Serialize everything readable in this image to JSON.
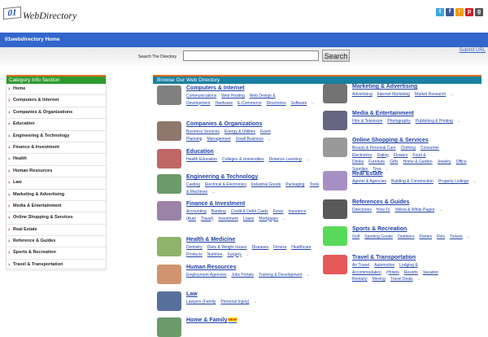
{
  "logo": {
    "num": "01",
    "name": "WebDirectory"
  },
  "social": [
    {
      "name": "twitter",
      "g": "t",
      "c": "#3aa7e0"
    },
    {
      "name": "facebook",
      "g": "f",
      "c": "#3b5998"
    },
    {
      "name": "rss",
      "g": "r",
      "c": "#f39c12"
    },
    {
      "name": "pinterest",
      "g": "p",
      "c": "#cb2027"
    },
    {
      "name": "google",
      "g": "g",
      "c": "#555555"
    }
  ],
  "nav": {
    "home": "01webdirectory Home"
  },
  "search": {
    "label": "Search The Directory",
    "value": "",
    "button": "Search",
    "submit_url": "Submit URL"
  },
  "sidebar": {
    "title": "Category Info Section",
    "items": [
      "Home",
      "Computers & Internet",
      "Companies & Organizations",
      "Education",
      "Engineering & Technology",
      "Finance & Investment",
      "Health",
      "Human Resources",
      "Law",
      "Marketing & Advertising",
      "Media & Entertainment",
      "Online Shopping & Services",
      "Real Estate",
      "Reference & Guides",
      "Sports & Recreation",
      "Travel & Transportation"
    ]
  },
  "directory": {
    "title": "Browse Our Web Directory",
    "left": [
      {
        "title": "Computers & Internet",
        "icon": "computer-icon",
        "subs": [
          "Communications",
          "Web Hosting",
          "Web Design & Development",
          "Hardware",
          "E-Commerce",
          "Directories",
          "Software"
        ]
      },
      {
        "title": "Companies & Organizations",
        "icon": "business-people-icon",
        "subs": [
          "Business Services",
          "Energy & Utilities",
          "Event Planning",
          "Management",
          "Small Business"
        ]
      },
      {
        "title": "Education",
        "icon": "book-icon",
        "subs": [
          "Health Education",
          "Colleges & Universities",
          "Distance Learning"
        ]
      },
      {
        "title": "Engineering & Technology",
        "icon": "engineer-icon",
        "subs": [
          "Casting",
          "Electrical & Electronics",
          "Industrial Goods",
          "Packaging",
          "Tools & Machines"
        ]
      },
      {
        "title": "Finance & Investment",
        "icon": "finance-icon",
        "subs": [
          "Accounting",
          "Banking",
          "Credit & Debit Cards",
          "Forex",
          "Insurance (Auto",
          "Travel)",
          "Investment",
          "Loans",
          "Mortgages"
        ]
      },
      {
        "title": "Health & Medicine",
        "icon": "microscope-icon",
        "subs": [
          "Dentistry",
          "Diets & Weight Issues",
          "Diseases",
          "Fitness",
          "Healthcare Products",
          "Nutrition",
          "Surgery"
        ]
      },
      {
        "title": "Human Resources",
        "icon": "meeting-icon",
        "subs": [
          "Employment Agencies",
          "Jobs Portals",
          "Training & Development"
        ]
      },
      {
        "title": "Law",
        "icon": "scales-icon",
        "subs": [
          "Lawyers (Family",
          "Personal Injury)"
        ]
      },
      {
        "title": "Home & Family",
        "icon": "family-icon",
        "badge": "NEW",
        "subs": []
      }
    ],
    "right": [
      {
        "title": "Marketing & Advertising",
        "icon": "presenter-icon",
        "subs": [
          "Advertising",
          "Internet Marketing",
          "Market Research"
        ]
      },
      {
        "title": "Media & Entertainment",
        "icon": "media-icon",
        "subs": [
          "Film & Television",
          "Photography",
          "Publishing & Printing"
        ]
      },
      {
        "title": "Online Shopping & Services",
        "icon": "cart-icon",
        "subs": [
          "Beauty & Personal Care",
          "Clothing",
          "Consumer Electronics",
          "Dating",
          "Flowers",
          "Food & Drinks",
          "Furniture",
          "Gifts",
          "Home & Garden",
          "Jewelry",
          "Office Supplies",
          "Toys"
        ]
      },
      {
        "title": "Real Estate",
        "icon": "house-icon",
        "subs": [
          "Agents & Agencies",
          "Building & Construction",
          "Property Listings"
        ]
      },
      {
        "title": "References & Guides",
        "icon": "organizer-icon",
        "subs": [
          "Directories",
          "How To",
          "Yellow & White Pages"
        ]
      },
      {
        "title": "Sports & Recreation",
        "icon": "golf-icon",
        "subs": [
          "Golf",
          "Sporting Goods",
          "Outdoors",
          "Parties",
          "Pets",
          "Tickets"
        ]
      },
      {
        "title": "Travel & Transportation",
        "icon": "bus-icon",
        "subs": [
          "Air Travel",
          "Automotive",
          "Lodging & Accommodation",
          "(Hotels",
          "Resorts",
          "Vacation Rentals)",
          "Moving",
          "Travel Deals"
        ]
      }
    ]
  }
}
